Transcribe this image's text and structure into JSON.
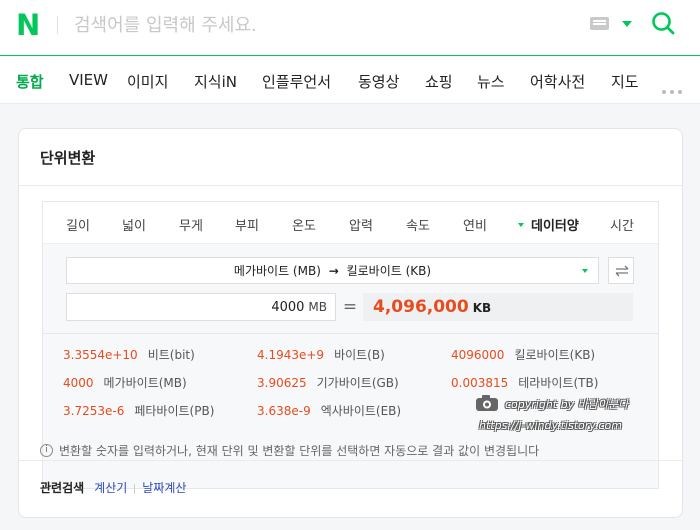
{
  "header": {
    "logo": "N",
    "search_placeholder": "검색어를 입력해 주세요."
  },
  "nav": {
    "tabs": [
      "통합",
      "VIEW",
      "이미지",
      "지식iN",
      "인플루언서",
      "동영상",
      "쇼핑",
      "뉴스",
      "어학사전",
      "지도"
    ],
    "active": "통합"
  },
  "card": {
    "title": "단위변환",
    "categories": [
      "길이",
      "넓이",
      "무게",
      "부피",
      "온도",
      "압력",
      "속도",
      "연비",
      "데이터양",
      "시간"
    ],
    "active_category": "데이터양",
    "from_unit": "메가바이트 (MB)",
    "arrow": "→",
    "to_unit": "킬로바이트 (KB)",
    "input_value": "4000",
    "input_unit": "MB",
    "equals": "=",
    "result_value": "4,096,000",
    "result_unit": "KB",
    "results": [
      {
        "value": "3.3554e+10",
        "unit": "비트(bit)"
      },
      {
        "value": "4.1943e+9",
        "unit": "바이트(B)"
      },
      {
        "value": "4096000",
        "unit": "킬로바이트(KB)"
      },
      {
        "value": "4000",
        "unit": "메가바이트(MB)"
      },
      {
        "value": "3.90625",
        "unit": "기가바이트(GB)"
      },
      {
        "value": "0.003815",
        "unit": "테라바이트(TB)"
      },
      {
        "value": "3.7253e-6",
        "unit": "페타바이트(PB)"
      },
      {
        "value": "3.638e-9",
        "unit": "엑사바이트(EB)"
      }
    ],
    "watermark_line1": "copyright by 바람이분다",
    "watermark_line2": "https://j-windy.tistory.com",
    "notice": "변환할 숫자를 입력하거나, 현재 단위 및 변환할 단위를 선택하면 자동으로 결과 값이 변경됩니다",
    "related_label": "관련검색",
    "related_links": [
      "계산기",
      "날짜계산"
    ]
  },
  "colors": {
    "brand": "#03c75a",
    "result": "#e84c1e",
    "link": "#2a4bbf"
  }
}
